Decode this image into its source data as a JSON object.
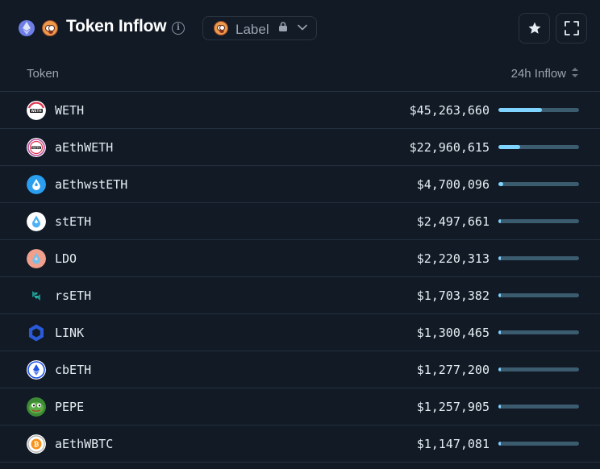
{
  "header": {
    "title": "Token Inflow",
    "label_button": "Label",
    "info_icon": "info-icon",
    "lock_icon": "lock-icon",
    "star_icon": "star-icon",
    "expand_icon": "expand-icon"
  },
  "table": {
    "columns": {
      "token": "Token",
      "inflow": "24h Inflow"
    },
    "max_value": 45263660,
    "rows": [
      {
        "name": "WETH",
        "value": "$45,263,660",
        "amount": 45263660,
        "icon": "weth-icon"
      },
      {
        "name": "aEthWETH",
        "value": "$22,960,615",
        "amount": 22960615,
        "icon": "aethweth-icon"
      },
      {
        "name": "aEthwstETH",
        "value": "$4,700,096",
        "amount": 4700096,
        "icon": "aethwsteth-icon"
      },
      {
        "name": "stETH",
        "value": "$2,497,661",
        "amount": 2497661,
        "icon": "steth-icon"
      },
      {
        "name": "LDO",
        "value": "$2,220,313",
        "amount": 2220313,
        "icon": "ldo-icon"
      },
      {
        "name": "rsETH",
        "value": "$1,703,382",
        "amount": 1703382,
        "icon": "rseth-icon"
      },
      {
        "name": "LINK",
        "value": "$1,300,465",
        "amount": 1300465,
        "icon": "link-icon"
      },
      {
        "name": "cbETH",
        "value": "$1,277,200",
        "amount": 1277200,
        "icon": "cbeth-icon"
      },
      {
        "name": "PEPE",
        "value": "$1,257,905",
        "amount": 1257905,
        "icon": "pepe-icon"
      },
      {
        "name": "aEthWBTC",
        "value": "$1,147,081",
        "amount": 1147081,
        "icon": "aethwbtc-icon"
      }
    ]
  },
  "colors": {
    "background": "#111a25",
    "bar_track": "#3b5b6f",
    "bar_fill": "#7fd3ff",
    "divider": "#243040"
  }
}
